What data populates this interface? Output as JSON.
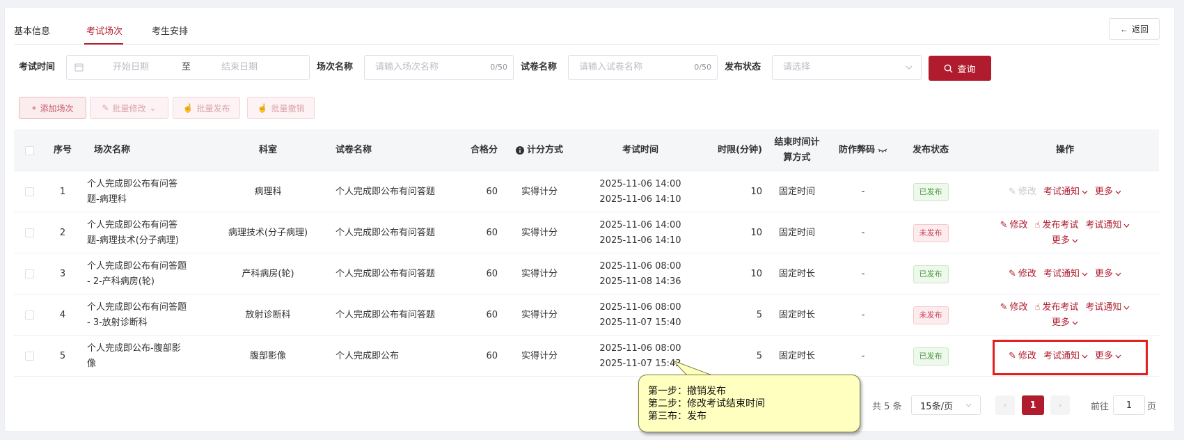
{
  "tabs": [
    "基本信息",
    "考试场次",
    "考生安排"
  ],
  "back_label": "返回",
  "filters": {
    "exam_time_label": "考试时间",
    "start_ph": "开始日期",
    "to_label": "至",
    "end_ph": "结束日期",
    "session_name_label": "场次名称",
    "session_name_ph": "请输入场次名称",
    "session_count": "0/50",
    "paper_name_label": "试卷名称",
    "paper_name_ph": "请输入试卷名称",
    "paper_count": "0/50",
    "status_label": "发布状态",
    "status_ph": "请选择",
    "query_label": "查询"
  },
  "actions": {
    "add": "添加场次",
    "batch_edit": "批量修改",
    "batch_publish": "批量发布",
    "batch_revoke": "批量撤销"
  },
  "columns": {
    "seq": "序号",
    "name": "场次名称",
    "dept": "科室",
    "paper": "试卷名称",
    "pass": "合格分",
    "score": "计分方式",
    "time": "考试时间",
    "limit": "时限(分钟)",
    "endcalc1": "结束时间计",
    "endcalc2": "算方式",
    "anticheat": "防作弊码",
    "status": "发布状态",
    "ops": "操作"
  },
  "rows": [
    {
      "seq": "1",
      "name1": "个人完成即公布有问答",
      "name2": "题-病理科",
      "dept": "病理科",
      "paper": "个人完成即公布有问答题",
      "pass": "60",
      "score": "实得计分",
      "t1": "2025-11-06 14:00",
      "t2": "2025-11-06 14:10",
      "limit": "10",
      "endcalc": "固定时间",
      "anticheat": "-",
      "status": "已发布"
    },
    {
      "seq": "2",
      "name1": "个人完成即公布有问答",
      "name2": "题-病理技术(分子病理)",
      "dept": "病理技术(分子病理)",
      "paper": "个人完成即公布有问答题",
      "pass": "60",
      "score": "实得计分",
      "t1": "2025-11-06 14:00",
      "t2": "2025-11-06 14:10",
      "limit": "10",
      "endcalc": "固定时间",
      "anticheat": "-",
      "status": "未发布"
    },
    {
      "seq": "3",
      "name1": "个人完成即公布有问答题",
      "name2": "- 2-产科病房(轮)",
      "dept": "产科病房(轮)",
      "paper": "个人完成即公布有问答题",
      "pass": "60",
      "score": "实得计分",
      "t1": "2025-11-06 08:00",
      "t2": "2025-11-08 14:36",
      "limit": "10",
      "endcalc": "固定时长",
      "anticheat": "-",
      "status": "已发布"
    },
    {
      "seq": "4",
      "name1": "个人完成即公布有问答题",
      "name2": "- 3-放射诊断科",
      "dept": "放射诊断科",
      "paper": "个人完成即公布有问答题",
      "pass": "60",
      "score": "实得计分",
      "t1": "2025-11-06 08:00",
      "t2": "2025-11-07 15:40",
      "limit": "5",
      "endcalc": "固定时长",
      "anticheat": "-",
      "status": "未发布"
    },
    {
      "seq": "5",
      "name1": "个人完成即公布-腹部影",
      "name2": "像",
      "dept": "腹部影像",
      "paper": "个人完成即公布",
      "pass": "60",
      "score": "实得计分",
      "t1": "2025-11-06 08:00",
      "t2": "2025-11-07 15:43",
      "limit": "5",
      "endcalc": "固定时长",
      "anticheat": "-",
      "status": "已发布"
    }
  ],
  "ops_labels": {
    "edit": "修改",
    "notify": "考试通知",
    "more": "更多",
    "publish": "发布考试"
  },
  "pagination": {
    "total": "共 5 条",
    "page_size": "15条/页",
    "current": "1",
    "goto": "前往",
    "goto_value": "1",
    "page_unit": "页"
  },
  "callout": {
    "line1": "第一步：撤销发布",
    "line2": "第二步：修改考试结束时间",
    "line3": "第三布：发布"
  },
  "colors": {
    "accent": "#b01c2e",
    "highlight": "#e0201e"
  }
}
